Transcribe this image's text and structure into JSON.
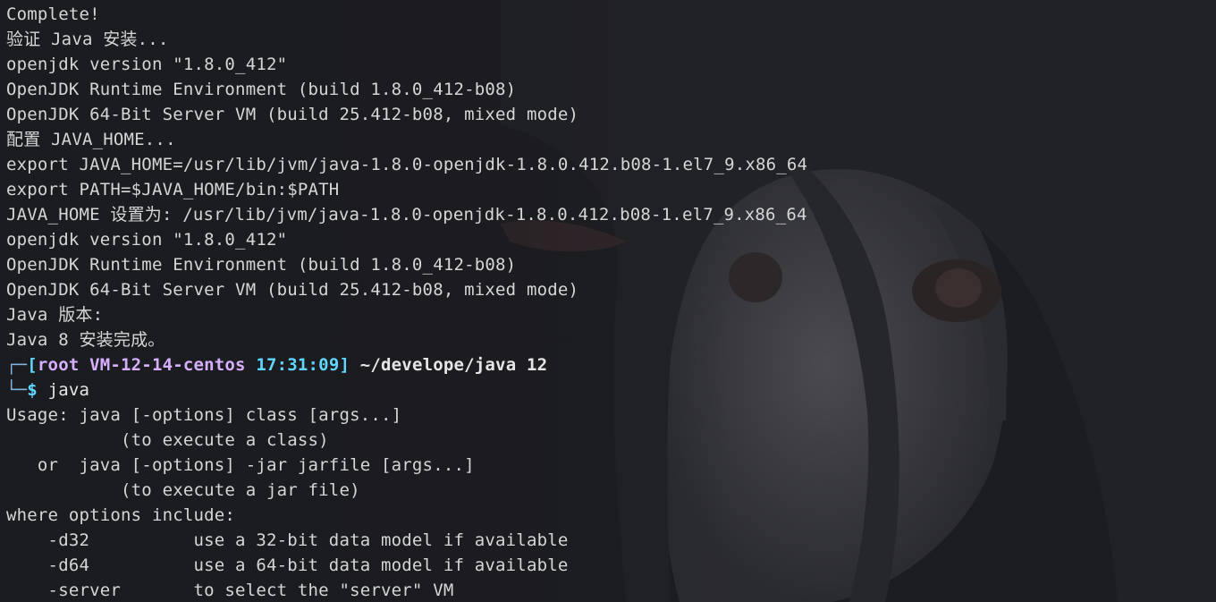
{
  "terminal": {
    "lines": [
      "Complete!",
      "验证 Java 安装...",
      "openjdk version \"1.8.0_412\"",
      "OpenJDK Runtime Environment (build 1.8.0_412-b08)",
      "OpenJDK 64-Bit Server VM (build 25.412-b08, mixed mode)",
      "配置 JAVA_HOME...",
      "export JAVA_HOME=/usr/lib/jvm/java-1.8.0-openjdk-1.8.0.412.b08-1.el7_9.x86_64",
      "export PATH=$JAVA_HOME/bin:$PATH",
      "JAVA_HOME 设置为: /usr/lib/jvm/java-1.8.0-openjdk-1.8.0.412.b08-1.el7_9.x86_64",
      "openjdk version \"1.8.0_412\"",
      "OpenJDK Runtime Environment (build 1.8.0_412-b08)",
      "OpenJDK 64-Bit Server VM (build 25.412-b08, mixed mode)",
      "Java 版本:",
      "Java 8 安装完成。"
    ],
    "prompt": {
      "box_top": "┌─",
      "box_bottom": "└─",
      "open_bracket": "[",
      "user_host": "root VM-12-14-centos",
      "time": "17:31:09",
      "close_bracket": "]",
      "cwd": "~/develope/java",
      "exit_code": "12",
      "dollar": "$",
      "command": "java"
    },
    "output_lines": [
      "Usage: java [-options] class [args...]",
      "           (to execute a class)",
      "   or  java [-options] -jar jarfile [args...]",
      "           (to execute a jar file)",
      "where options include:",
      "    -d32          use a 32-bit data model if available",
      "    -d64          use a 64-bit data model if available",
      "    -server       to select the \"server\" VM"
    ]
  },
  "colors": {
    "background": "#1b1c1f",
    "text": "#d4d6d8",
    "prompt_user": "#d7afff",
    "prompt_accent": "#5fd7ff"
  }
}
